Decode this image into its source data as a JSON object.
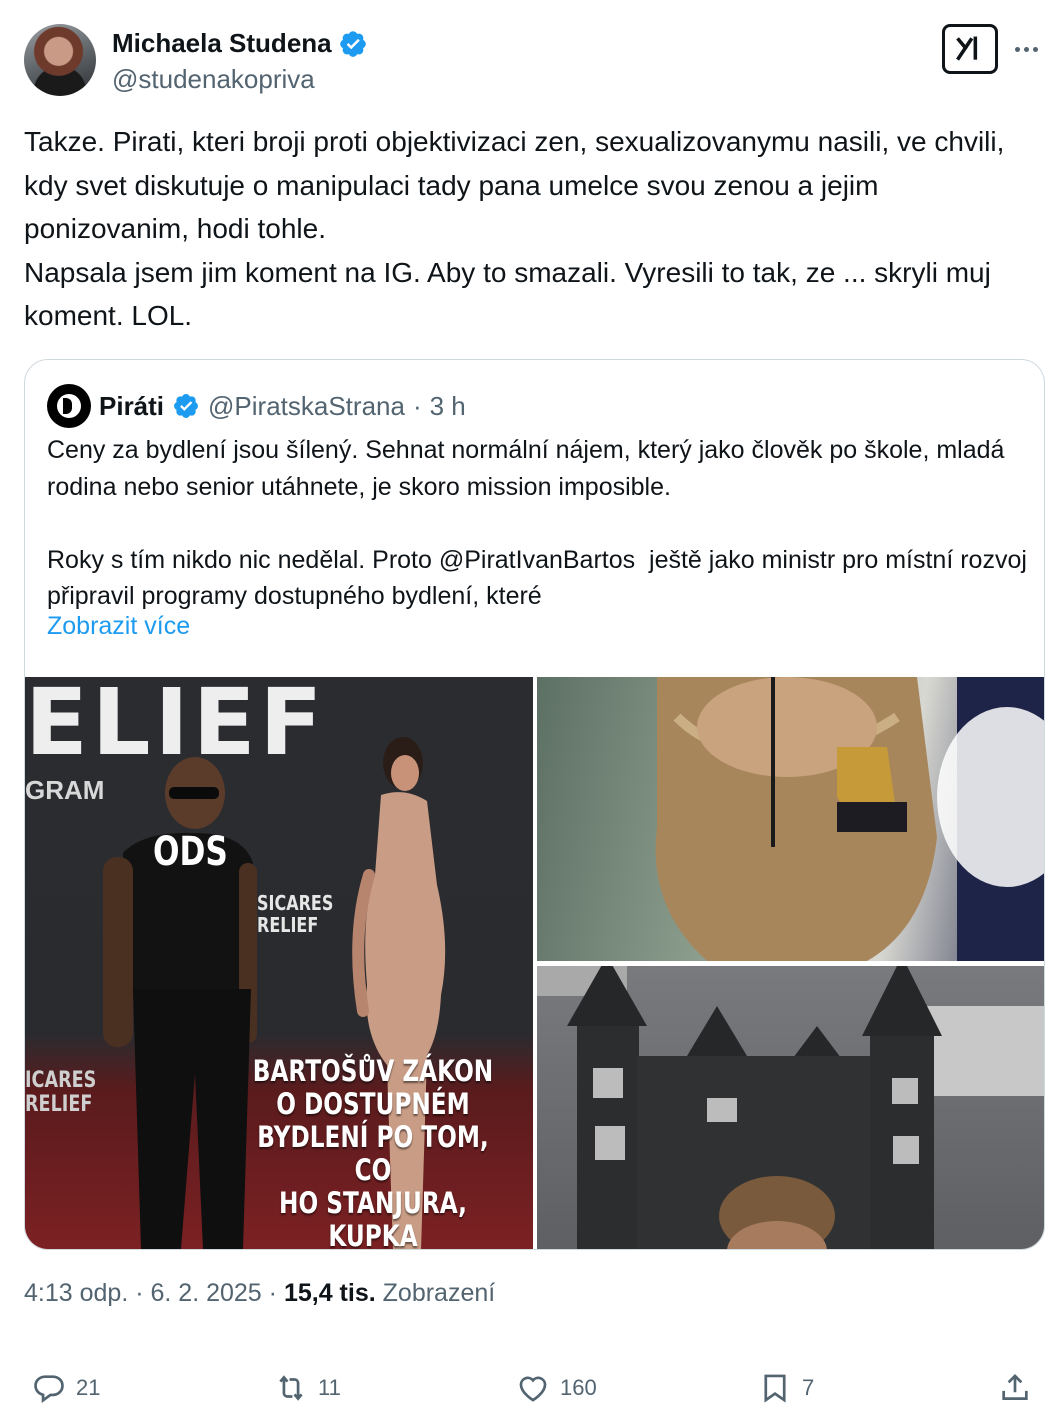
{
  "author": {
    "name": "Michaela Studena",
    "handle": "@studenakopriva",
    "verified_icon": "verified-badge-icon"
  },
  "toolbar": {
    "grok_icon": "grok-icon",
    "more_icon": "more-dots-icon"
  },
  "tweet": {
    "text": "Takze. Pirati, kteri broji proti objektivizaci zen, sexualizovanymu nasili, ve chvili, kdy svet diskutuje o manipulaci tady pana umelce svou zenou a jejim ponizovanim, hodi tohle.\nNapsala jsem jim koment na IG. Aby to smazali. Vyresili to tak, ze ... skryli muj koment. LOL."
  },
  "quote": {
    "name": "Piráti",
    "handle": "@PiratskaStrana",
    "separator": "·",
    "time": "3 h",
    "text": "Ceny za bydlení jsou šílený. Sehnat normální nájem, který jako člověk po škole, mladá rodina nebo senior utáhnete, je skoro mission imposible.\n\nRoky s tím nikdo nic nedělal. Proto @PiratIvanBartos  ještě jako ministr pro místní rozvoj připravil programy dostupného bydlení, které",
    "show_more": "Zobrazit více",
    "images": {
      "left": {
        "backdrop_text": "ELIEF",
        "backdrop_small": "GRAM",
        "backdrop_sponsor_1": "SICARES\nRELIEF",
        "backdrop_sponsor_2": "ICARES\nRELIEF",
        "shirt_text": "ODS",
        "caption": "BARTOŠŮV ZÁKON\nO DOSTUPNÉM\nBYDLENÍ PO TOM, CO\nHO STANJURA, KUPKA\nA FIALA “TROCHU” OSEKALI"
      }
    }
  },
  "meta": {
    "time": "4:13 odp.",
    "sep1": "·",
    "date": "6. 2. 2025",
    "sep2": "·",
    "views_count": "15,4 tis.",
    "views_label": "Zobrazení"
  },
  "actions": {
    "replies": "21",
    "reposts": "11",
    "likes": "160",
    "bookmarks": "7"
  },
  "colors": {
    "text": "#0f1419",
    "secondary": "#536471",
    "link": "#1d9bf0",
    "border": "#cfd9de",
    "verified": "#1d9bf0"
  }
}
